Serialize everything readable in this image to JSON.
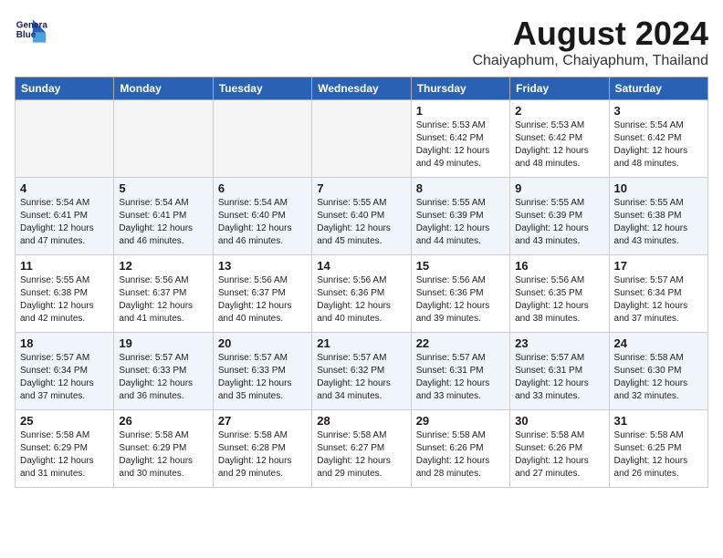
{
  "header": {
    "logo_line1": "General",
    "logo_line2": "Blue",
    "main_title": "August 2024",
    "subtitle": "Chaiyaphum, Chaiyaphum, Thailand"
  },
  "weekdays": [
    "Sunday",
    "Monday",
    "Tuesday",
    "Wednesday",
    "Thursday",
    "Friday",
    "Saturday"
  ],
  "weeks": [
    [
      {
        "day": "",
        "info": ""
      },
      {
        "day": "",
        "info": ""
      },
      {
        "day": "",
        "info": ""
      },
      {
        "day": "",
        "info": ""
      },
      {
        "day": "1",
        "info": "Sunrise: 5:53 AM\nSunset: 6:42 PM\nDaylight: 12 hours\nand 49 minutes."
      },
      {
        "day": "2",
        "info": "Sunrise: 5:53 AM\nSunset: 6:42 PM\nDaylight: 12 hours\nand 48 minutes."
      },
      {
        "day": "3",
        "info": "Sunrise: 5:54 AM\nSunset: 6:42 PM\nDaylight: 12 hours\nand 48 minutes."
      }
    ],
    [
      {
        "day": "4",
        "info": "Sunrise: 5:54 AM\nSunset: 6:41 PM\nDaylight: 12 hours\nand 47 minutes."
      },
      {
        "day": "5",
        "info": "Sunrise: 5:54 AM\nSunset: 6:41 PM\nDaylight: 12 hours\nand 46 minutes."
      },
      {
        "day": "6",
        "info": "Sunrise: 5:54 AM\nSunset: 6:40 PM\nDaylight: 12 hours\nand 46 minutes."
      },
      {
        "day": "7",
        "info": "Sunrise: 5:55 AM\nSunset: 6:40 PM\nDaylight: 12 hours\nand 45 minutes."
      },
      {
        "day": "8",
        "info": "Sunrise: 5:55 AM\nSunset: 6:39 PM\nDaylight: 12 hours\nand 44 minutes."
      },
      {
        "day": "9",
        "info": "Sunrise: 5:55 AM\nSunset: 6:39 PM\nDaylight: 12 hours\nand 43 minutes."
      },
      {
        "day": "10",
        "info": "Sunrise: 5:55 AM\nSunset: 6:38 PM\nDaylight: 12 hours\nand 43 minutes."
      }
    ],
    [
      {
        "day": "11",
        "info": "Sunrise: 5:55 AM\nSunset: 6:38 PM\nDaylight: 12 hours\nand 42 minutes."
      },
      {
        "day": "12",
        "info": "Sunrise: 5:56 AM\nSunset: 6:37 PM\nDaylight: 12 hours\nand 41 minutes."
      },
      {
        "day": "13",
        "info": "Sunrise: 5:56 AM\nSunset: 6:37 PM\nDaylight: 12 hours\nand 40 minutes."
      },
      {
        "day": "14",
        "info": "Sunrise: 5:56 AM\nSunset: 6:36 PM\nDaylight: 12 hours\nand 40 minutes."
      },
      {
        "day": "15",
        "info": "Sunrise: 5:56 AM\nSunset: 6:36 PM\nDaylight: 12 hours\nand 39 minutes."
      },
      {
        "day": "16",
        "info": "Sunrise: 5:56 AM\nSunset: 6:35 PM\nDaylight: 12 hours\nand 38 minutes."
      },
      {
        "day": "17",
        "info": "Sunrise: 5:57 AM\nSunset: 6:34 PM\nDaylight: 12 hours\nand 37 minutes."
      }
    ],
    [
      {
        "day": "18",
        "info": "Sunrise: 5:57 AM\nSunset: 6:34 PM\nDaylight: 12 hours\nand 37 minutes."
      },
      {
        "day": "19",
        "info": "Sunrise: 5:57 AM\nSunset: 6:33 PM\nDaylight: 12 hours\nand 36 minutes."
      },
      {
        "day": "20",
        "info": "Sunrise: 5:57 AM\nSunset: 6:33 PM\nDaylight: 12 hours\nand 35 minutes."
      },
      {
        "day": "21",
        "info": "Sunrise: 5:57 AM\nSunset: 6:32 PM\nDaylight: 12 hours\nand 34 minutes."
      },
      {
        "day": "22",
        "info": "Sunrise: 5:57 AM\nSunset: 6:31 PM\nDaylight: 12 hours\nand 33 minutes."
      },
      {
        "day": "23",
        "info": "Sunrise: 5:57 AM\nSunset: 6:31 PM\nDaylight: 12 hours\nand 33 minutes."
      },
      {
        "day": "24",
        "info": "Sunrise: 5:58 AM\nSunset: 6:30 PM\nDaylight: 12 hours\nand 32 minutes."
      }
    ],
    [
      {
        "day": "25",
        "info": "Sunrise: 5:58 AM\nSunset: 6:29 PM\nDaylight: 12 hours\nand 31 minutes."
      },
      {
        "day": "26",
        "info": "Sunrise: 5:58 AM\nSunset: 6:29 PM\nDaylight: 12 hours\nand 30 minutes."
      },
      {
        "day": "27",
        "info": "Sunrise: 5:58 AM\nSunset: 6:28 PM\nDaylight: 12 hours\nand 29 minutes."
      },
      {
        "day": "28",
        "info": "Sunrise: 5:58 AM\nSunset: 6:27 PM\nDaylight: 12 hours\nand 29 minutes."
      },
      {
        "day": "29",
        "info": "Sunrise: 5:58 AM\nSunset: 6:26 PM\nDaylight: 12 hours\nand 28 minutes."
      },
      {
        "day": "30",
        "info": "Sunrise: 5:58 AM\nSunset: 6:26 PM\nDaylight: 12 hours\nand 27 minutes."
      },
      {
        "day": "31",
        "info": "Sunrise: 5:58 AM\nSunset: 6:25 PM\nDaylight: 12 hours\nand 26 minutes."
      }
    ]
  ]
}
